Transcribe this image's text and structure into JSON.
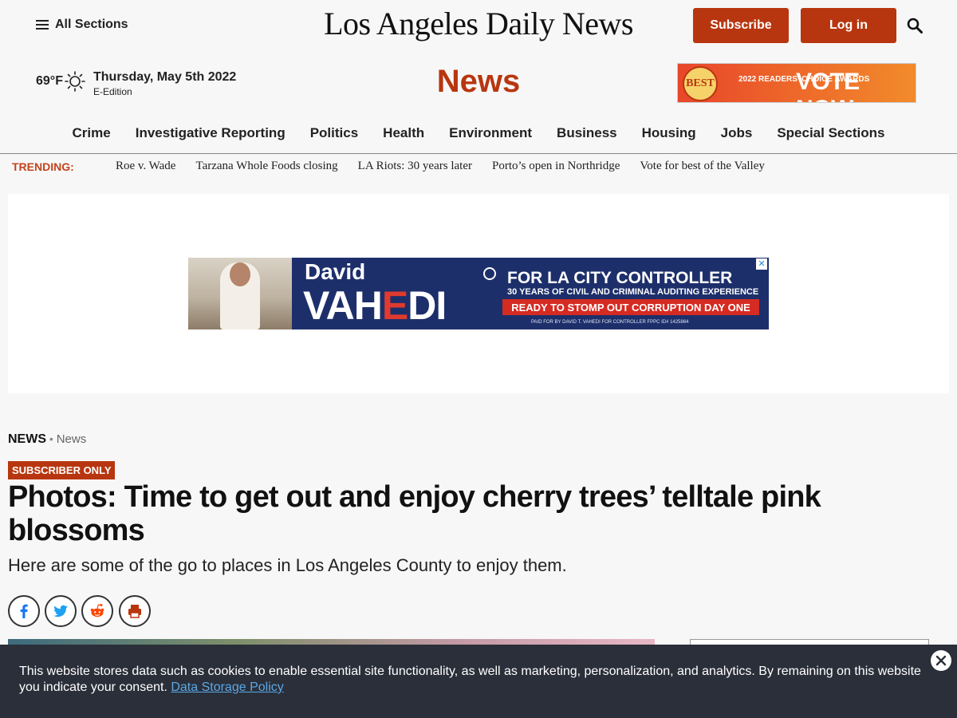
{
  "header": {
    "all_sections": "All Sections",
    "masthead": "Los Angeles Daily News",
    "subscribe": "Subscribe",
    "login": "Log in"
  },
  "info": {
    "temperature": "69°F",
    "date": "Thursday, May 5th 2022",
    "eedition": "E-Edition",
    "section_title": "News"
  },
  "top_ad": {
    "badge": "BEST",
    "awards": "2022 READERS' CHOICE AWARDS",
    "cta": "VOTE NOW"
  },
  "nav": {
    "items": [
      "Crime",
      "Investigative Reporting",
      "Politics",
      "Health",
      "Environment",
      "Business",
      "Housing",
      "Jobs",
      "Special Sections"
    ]
  },
  "trending": {
    "label": "TRENDING:",
    "items": [
      "Roe v. Wade",
      "Tarzana Whole Foods closing",
      "LA Riots: 30 years later",
      "Porto’s open in Northridge",
      "Vote for best of the Valley"
    ]
  },
  "banner_ad": {
    "first_name": "David",
    "last_name_a": "VAH",
    "last_name_b": "E",
    "last_name_c": "DI",
    "headline": "FOR LA CITY CONTROLLER",
    "subline": "30 YEARS OF CIVIL AND CRIMINAL AUDITING EXPERIENCE",
    "cta": "READY TO STOMP OUT CORRUPTION DAY ONE",
    "paid_for": "PAID FOR BY DAVID T. VAHEDI FOR CONTROLLER FPPC ID# 1425864",
    "close": "✕"
  },
  "article": {
    "breadcrumb_main": "NEWS",
    "breadcrumb_sep": " • ",
    "breadcrumb_sub": "News",
    "badge": "SUBSCRIBER ONLY",
    "headline": "Photos: Time to get out and enjoy cherry trees’ telltale pink blossoms",
    "dek": "Here are some of the go to places in Los Angeles County to enjoy them."
  },
  "cookie": {
    "text": "This website stores data such as cookies to enable essential site functionality, as well as marketing, personalization, and analytics. By remaining on this website you indicate your consent. ",
    "link": "Data Storage Policy"
  },
  "colors": {
    "brand_red": "#b8360f",
    "cookie_bg": "#2b2f3a",
    "facebook": "#1877f2",
    "twitter": "#1da1f2",
    "reddit": "#ff4500"
  }
}
